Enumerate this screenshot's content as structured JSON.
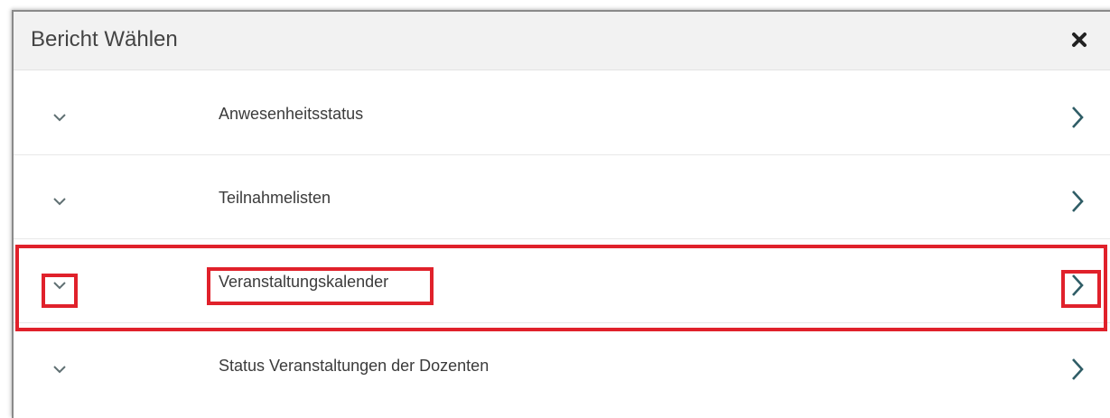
{
  "dialog": {
    "title": "Bericht Wählen",
    "close_icon": "close-icon"
  },
  "reports": [
    {
      "label": "Anwesenheitsstatus",
      "expand_icon": "chevron-down-icon",
      "open_icon": "chevron-right-icon"
    },
    {
      "label": "Teilnahmelisten",
      "expand_icon": "chevron-down-icon",
      "open_icon": "chevron-right-icon"
    },
    {
      "label": "Veranstaltungskalender",
      "expand_icon": "chevron-down-icon",
      "open_icon": "chevron-right-icon",
      "highlighted": true
    },
    {
      "label": "Status Veranstaltungen der Dozenten",
      "expand_icon": "chevron-down-icon",
      "open_icon": "chevron-right-icon"
    }
  ],
  "colors": {
    "highlight": "#e0212b",
    "chevron_right": "#2f5d66",
    "chevron_down": "#5f6f72",
    "header_bg": "#f2f2f2"
  }
}
